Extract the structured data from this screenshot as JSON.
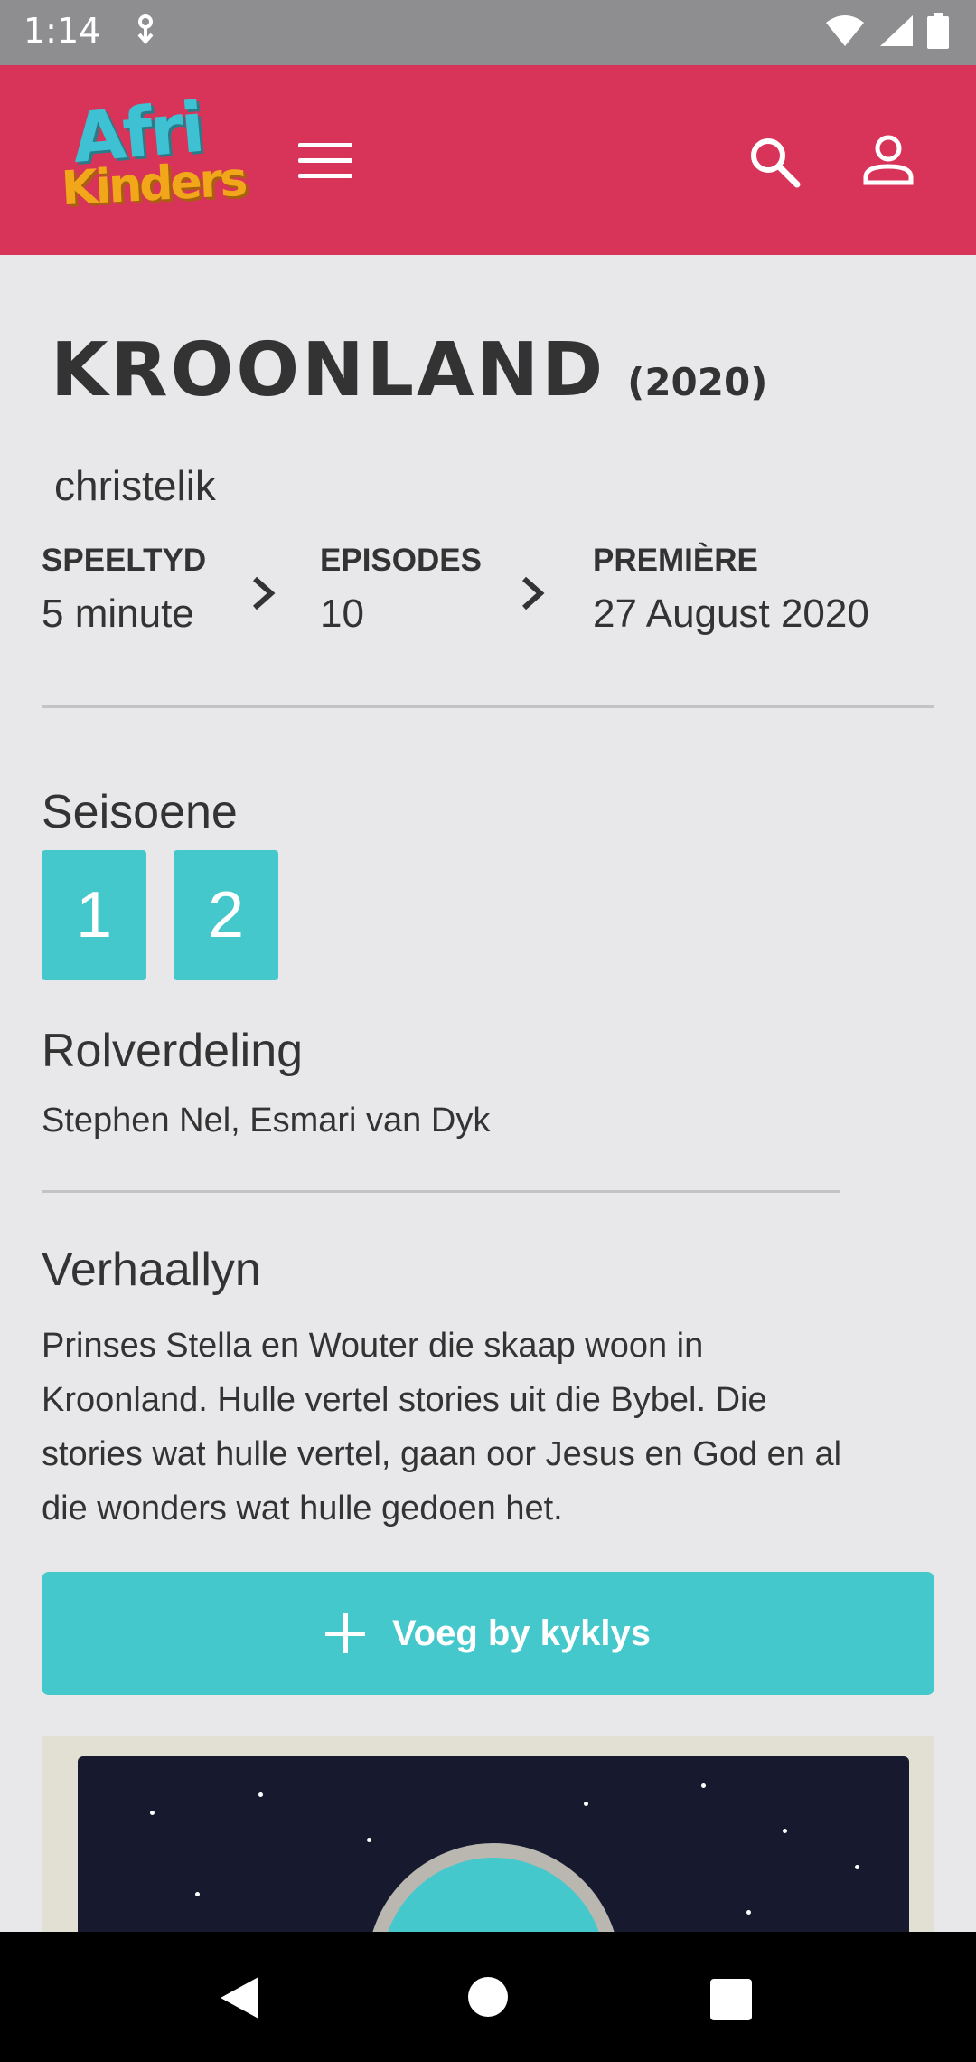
{
  "status_bar": {
    "time": "1:14",
    "icons": [
      "vpn-key-icon",
      "wifi-icon",
      "signal-icon",
      "battery-icon"
    ]
  },
  "header": {
    "logo_line1": "Afri",
    "logo_line2": "Kinders",
    "brand_color": "#d8345a",
    "icons": [
      "menu-icon",
      "search-icon",
      "account-icon"
    ]
  },
  "show": {
    "title": "KROONLAND",
    "year": "(2020)",
    "genre": "christelik"
  },
  "meta": [
    {
      "label": "SPEELTYD",
      "value": "5 minute"
    },
    {
      "label": "EPISODES",
      "value": "10"
    },
    {
      "label": "PREMIÈRE",
      "value": "27 August 2020"
    }
  ],
  "seasons": {
    "heading": "Seisoene",
    "items": [
      "1",
      "2"
    ],
    "accent_color": "#45c8cb"
  },
  "cast": {
    "heading": "Rolverdeling",
    "names": "Stephen Nel,  Esmari van Dyk"
  },
  "synopsis": {
    "heading": "Verhaallyn",
    "text": "Prinses Stella en Wouter die skaap woon in Kroonland. Hulle vertel stories uit die Bybel. Die stories wat hulle vertel, gaan oor Jesus en God en al die wonders wat hulle gedoen het."
  },
  "watchlist": {
    "label": "Voeg by kyklys"
  },
  "nav_bar": {
    "icons": [
      "back-icon",
      "home-icon",
      "recents-icon"
    ]
  }
}
